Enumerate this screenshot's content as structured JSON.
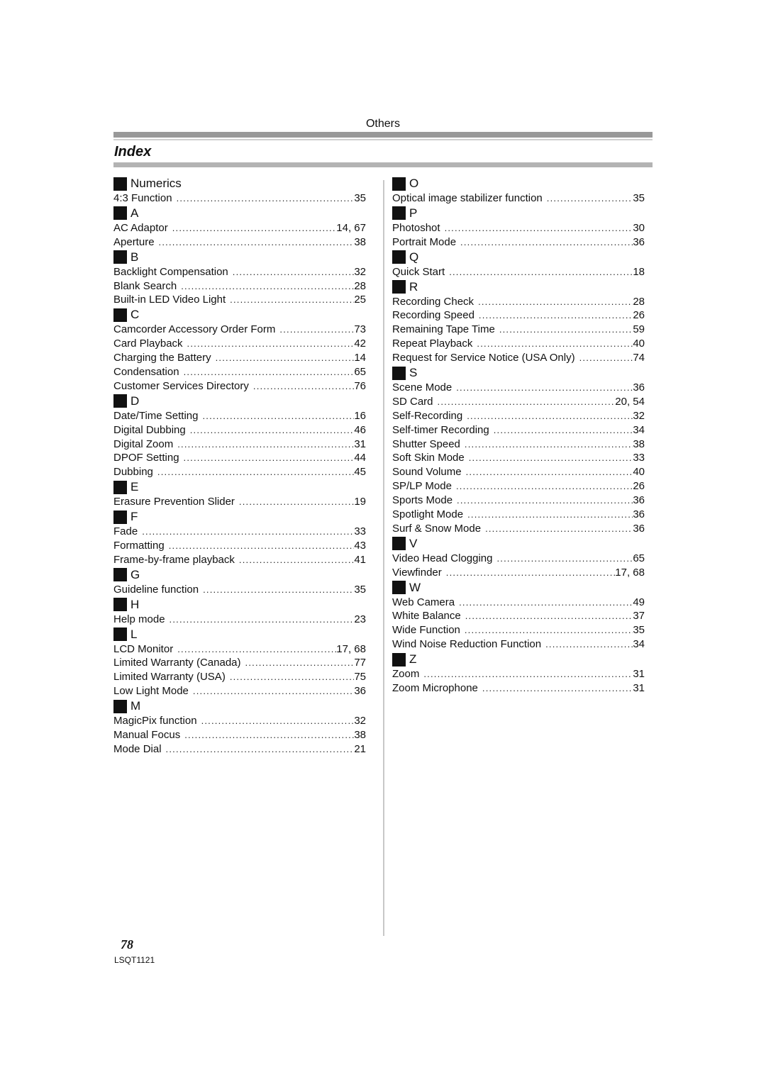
{
  "header": {
    "section": "Others",
    "title": "Index"
  },
  "left_column": [
    {
      "letter": "Numerics",
      "entries": [
        {
          "name": "4:3 Function",
          "page": "35"
        }
      ]
    },
    {
      "letter": "A",
      "entries": [
        {
          "name": "AC Adaptor",
          "page": "14, 67"
        },
        {
          "name": "Aperture",
          "page": "38"
        }
      ]
    },
    {
      "letter": "B",
      "entries": [
        {
          "name": "Backlight Compensation",
          "page": "32"
        },
        {
          "name": "Blank Search",
          "page": "28"
        },
        {
          "name": "Built-in LED Video Light",
          "page": "25"
        }
      ]
    },
    {
      "letter": "C",
      "entries": [
        {
          "name": "Camcorder Accessory Order Form",
          "page": "73"
        },
        {
          "name": "Card Playback",
          "page": "42"
        },
        {
          "name": "Charging the Battery",
          "page": "14"
        },
        {
          "name": "Condensation",
          "page": "65"
        },
        {
          "name": "Customer Services Directory",
          "page": "76"
        }
      ]
    },
    {
      "letter": "D",
      "entries": [
        {
          "name": "Date/Time Setting",
          "page": "16"
        },
        {
          "name": "Digital Dubbing",
          "page": "46"
        },
        {
          "name": "Digital Zoom",
          "page": "31"
        },
        {
          "name": "DPOF Setting",
          "page": "44"
        },
        {
          "name": "Dubbing",
          "page": "45"
        }
      ]
    },
    {
      "letter": "E",
      "entries": [
        {
          "name": "Erasure Prevention Slider",
          "page": "19"
        }
      ]
    },
    {
      "letter": "F",
      "entries": [
        {
          "name": "Fade",
          "page": "33"
        },
        {
          "name": "Formatting",
          "page": "43"
        },
        {
          "name": "Frame-by-frame playback",
          "page": "41"
        }
      ]
    },
    {
      "letter": "G",
      "entries": [
        {
          "name": "Guideline function",
          "page": "35"
        }
      ]
    },
    {
      "letter": "H",
      "entries": [
        {
          "name": "Help mode",
          "page": "23"
        }
      ]
    },
    {
      "letter": "L",
      "entries": [
        {
          "name": "LCD Monitor",
          "page": "17, 68"
        },
        {
          "name": "Limited Warranty (Canada)",
          "page": "77"
        },
        {
          "name": "Limited Warranty (USA)",
          "page": "75"
        },
        {
          "name": "Low Light Mode",
          "page": "36"
        }
      ]
    },
    {
      "letter": "M",
      "entries": [
        {
          "name": "MagicPix function",
          "page": "32"
        },
        {
          "name": "Manual Focus",
          "page": "38"
        },
        {
          "name": "Mode Dial",
          "page": "21"
        }
      ]
    }
  ],
  "right_column": [
    {
      "letter": "O",
      "entries": [
        {
          "name": "Optical image stabilizer function",
          "page": "35"
        }
      ]
    },
    {
      "letter": "P",
      "entries": [
        {
          "name": "Photoshot",
          "page": "30"
        },
        {
          "name": "Portrait Mode",
          "page": "36"
        }
      ]
    },
    {
      "letter": "Q",
      "entries": [
        {
          "name": "Quick Start",
          "page": "18"
        }
      ]
    },
    {
      "letter": "R",
      "entries": [
        {
          "name": "Recording Check",
          "page": "28"
        },
        {
          "name": "Recording Speed",
          "page": "26"
        },
        {
          "name": "Remaining Tape Time",
          "page": "59"
        },
        {
          "name": "Repeat Playback",
          "page": "40"
        },
        {
          "name": "Request for Service Notice (USA Only)",
          "page": "74"
        }
      ]
    },
    {
      "letter": "S",
      "entries": [
        {
          "name": "Scene Mode",
          "page": "36"
        },
        {
          "name": "SD Card",
          "page": "20, 54"
        },
        {
          "name": "Self-Recording",
          "page": "32"
        },
        {
          "name": "Self-timer Recording",
          "page": "34"
        },
        {
          "name": "Shutter Speed",
          "page": "38"
        },
        {
          "name": "Soft Skin Mode",
          "page": "33"
        },
        {
          "name": "Sound Volume",
          "page": "40"
        },
        {
          "name": "SP/LP Mode",
          "page": "26"
        },
        {
          "name": "Sports Mode",
          "page": "36"
        },
        {
          "name": "Spotlight Mode",
          "page": "36"
        },
        {
          "name": "Surf & Snow Mode",
          "page": "36"
        }
      ]
    },
    {
      "letter": "V",
      "entries": [
        {
          "name": "Video Head Clogging",
          "page": "65"
        },
        {
          "name": "Viewfinder",
          "page": "17, 68"
        }
      ]
    },
    {
      "letter": "W",
      "entries": [
        {
          "name": "Web Camera",
          "page": "49"
        },
        {
          "name": "White Balance",
          "page": "37"
        },
        {
          "name": "Wide Function",
          "page": "35"
        },
        {
          "name": "Wind Noise Reduction Function",
          "page": "34"
        }
      ]
    },
    {
      "letter": "Z",
      "entries": [
        {
          "name": "Zoom",
          "page": "31"
        },
        {
          "name": "Zoom Microphone",
          "page": "31"
        }
      ]
    }
  ],
  "footer": {
    "page_number": "78",
    "doc_code": "LSQT1121"
  }
}
